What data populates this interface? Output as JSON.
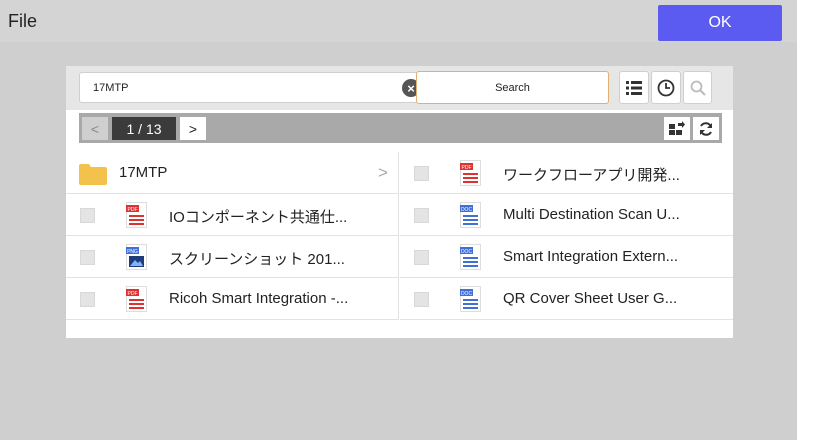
{
  "header": {
    "title": "File",
    "ok_label": "OK"
  },
  "search": {
    "value": "17MTP",
    "button_label": "Search"
  },
  "pager": {
    "prev": "<",
    "page": "1 / 13",
    "next": ">"
  },
  "folder": {
    "name": "17MTP",
    "chevron": ">"
  },
  "files": [
    {
      "name": "ワークフローアプリ開発...",
      "type_badge": "PDF"
    },
    {
      "name": "IOコンポーネント共通仕...",
      "type_badge": "PDF"
    },
    {
      "name": "Multi Destination Scan U...",
      "type_badge": "DOC"
    },
    {
      "name": "スクリーンショット 201...",
      "type_badge": "PNG"
    },
    {
      "name": "Smart Integration Extern...",
      "type_badge": "DOC"
    },
    {
      "name": "Ricoh Smart Integration -...",
      "type_badge": "PDF"
    },
    {
      "name": "QR Cover Sheet User G...",
      "type_badge": "DOC"
    }
  ],
  "colors": {
    "ok": "#5b5bf2",
    "pdf": "#e03131",
    "doc": "#3f6fd8",
    "folder": "#f2c24c"
  },
  "icons": [
    "clear-icon",
    "list-view-icon",
    "history-icon",
    "search-icon",
    "sort-icon",
    "refresh-icon"
  ]
}
